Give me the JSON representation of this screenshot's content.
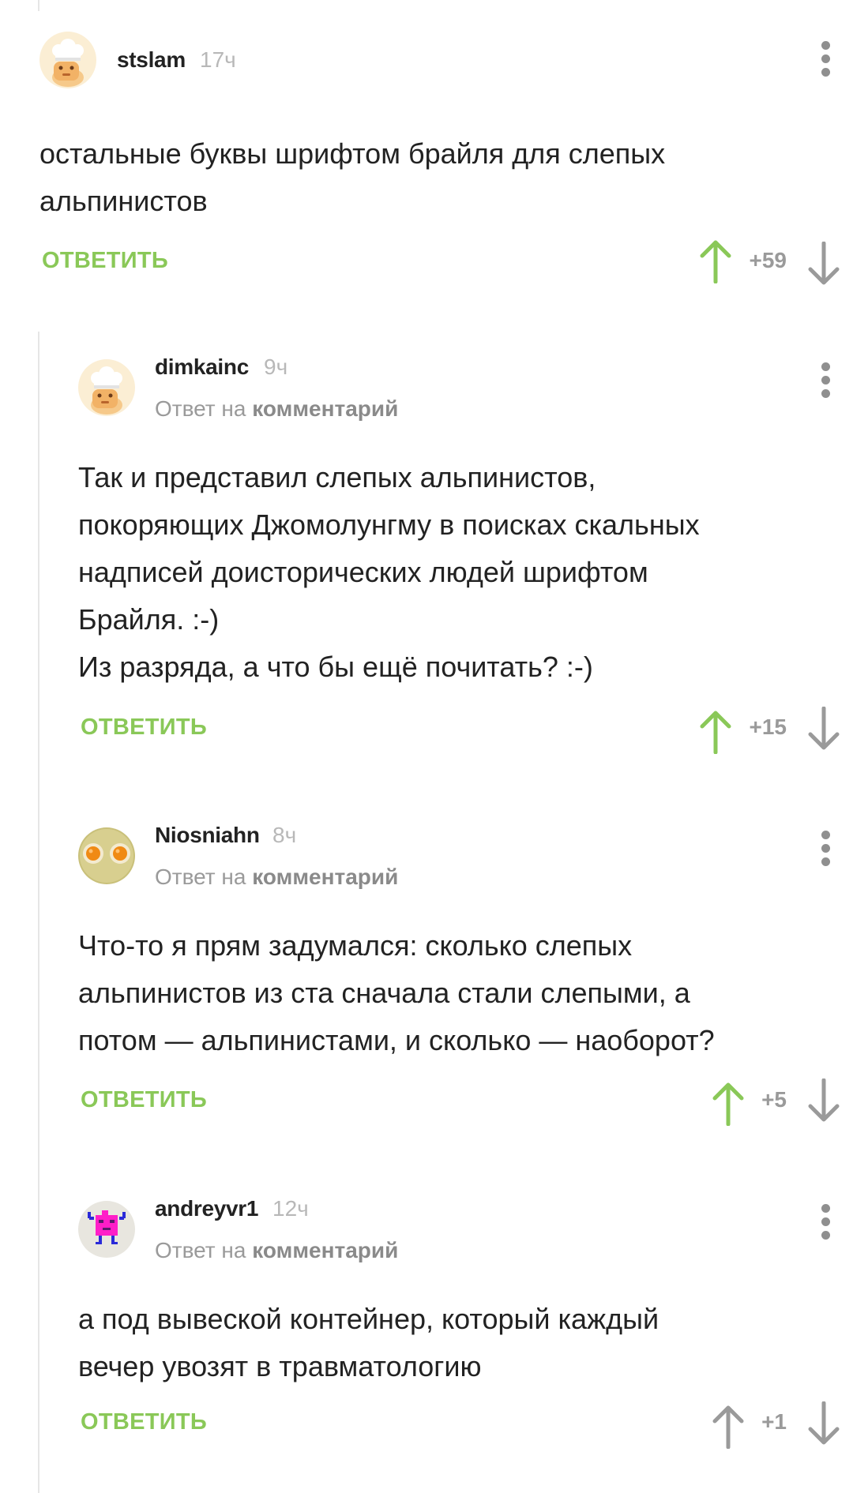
{
  "colors": {
    "accent_green": "#8ac858",
    "text": "#222222",
    "muted": "#9a9a9a",
    "arrow_gray": "#9a9a9a",
    "thread_line": "#e6e6e6"
  },
  "icons": {
    "more": "vertical-dots-icon",
    "upvote": "arrow-up-icon",
    "downvote": "arrow-down-icon"
  },
  "comments": [
    {
      "author": "stslam",
      "time": "17ч",
      "avatar": "chef-avatar",
      "reply_prefix": "",
      "reply_link": "",
      "text": "остальные буквы шрифтом брайля для слепых\nальпинистов",
      "reply_label": "ОТВЕТИТЬ",
      "score": "+59",
      "upvoted": true
    },
    {
      "author": "dimkainc",
      "time": "9ч",
      "avatar": "chef-avatar",
      "reply_prefix": "Ответ на ",
      "reply_link": "комментарий",
      "text": "Так и представил слепых альпинистов,\nпокоряющих Джомолунгму в поисках скальных\nнадписей доисторических людей шрифтом\nБрайля. :-)\nИз разряда, а что бы ещё почитать? :-)",
      "reply_label": "ОТВЕТИТЬ",
      "score": "+15",
      "upvoted": true
    },
    {
      "author": "Niosniahn",
      "time": "8ч",
      "avatar": "eggs-avatar",
      "reply_prefix": "Ответ на ",
      "reply_link": "комментарий",
      "text": "Что-то я прям задумался: сколько слепых\nальпинистов из ста сначала стали слепыми, а\nпотом — альпинистами, и сколько — наоборот?",
      "reply_label": "ОТВЕТИТЬ",
      "score": "+5",
      "upvoted": true
    },
    {
      "author": "andreyvr1",
      "time": "12ч",
      "avatar": "pixel-robot-avatar",
      "reply_prefix": "Ответ на ",
      "reply_link": "комментарий",
      "text": "а под вывеской контейнер, который каждый\nвечер увозят в травматологию",
      "reply_label": "ОТВЕТИТЬ",
      "score": "+1",
      "upvoted": false
    }
  ]
}
